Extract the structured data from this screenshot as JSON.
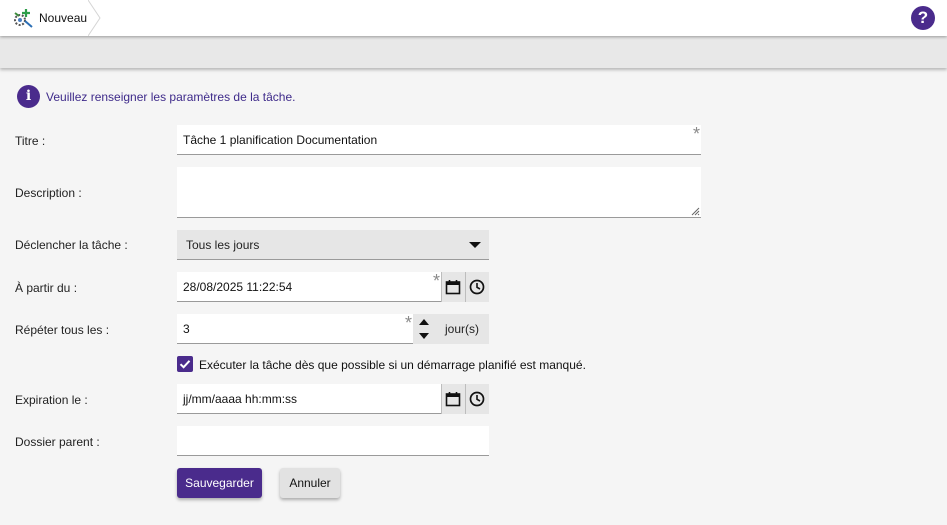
{
  "header": {
    "breadcrumb_label": "Nouveau",
    "help_label": "?"
  },
  "info": {
    "icon_label": "i",
    "message": "Veuillez renseigner les paramètres de la tâche."
  },
  "form": {
    "title": {
      "label": "Titre :",
      "value": "Tâche 1 planification Documentation",
      "required": true
    },
    "description": {
      "label": "Description :",
      "value": ""
    },
    "trigger": {
      "label": "Déclencher la tâche :",
      "value": "Tous les jours"
    },
    "start": {
      "label": "À partir du :",
      "value": "28/08/2025 11:22:54",
      "required": true
    },
    "repeat": {
      "label": "Répéter tous les :",
      "value": "3",
      "unit": "jour(s)",
      "required": true
    },
    "run_missed": {
      "label": "Exécuter la tâche dès que possible si un démarrage planifié est manqué.",
      "checked": true
    },
    "expiration": {
      "label": "Expiration le :",
      "placeholder": "jj/mm/aaaa hh:mm:ss"
    },
    "parent_folder": {
      "label": "Dossier parent :",
      "value": ""
    }
  },
  "actions": {
    "save_label": "Sauvegarder",
    "cancel_label": "Annuler"
  },
  "colors": {
    "accent": "#4a2b8c",
    "info_text": "#3e2a8a"
  },
  "icons": {
    "breadcrumb": "task-scheduler-icon",
    "help": "help-icon",
    "info": "info-icon",
    "calendar": "calendar-icon",
    "clock": "clock-icon"
  }
}
